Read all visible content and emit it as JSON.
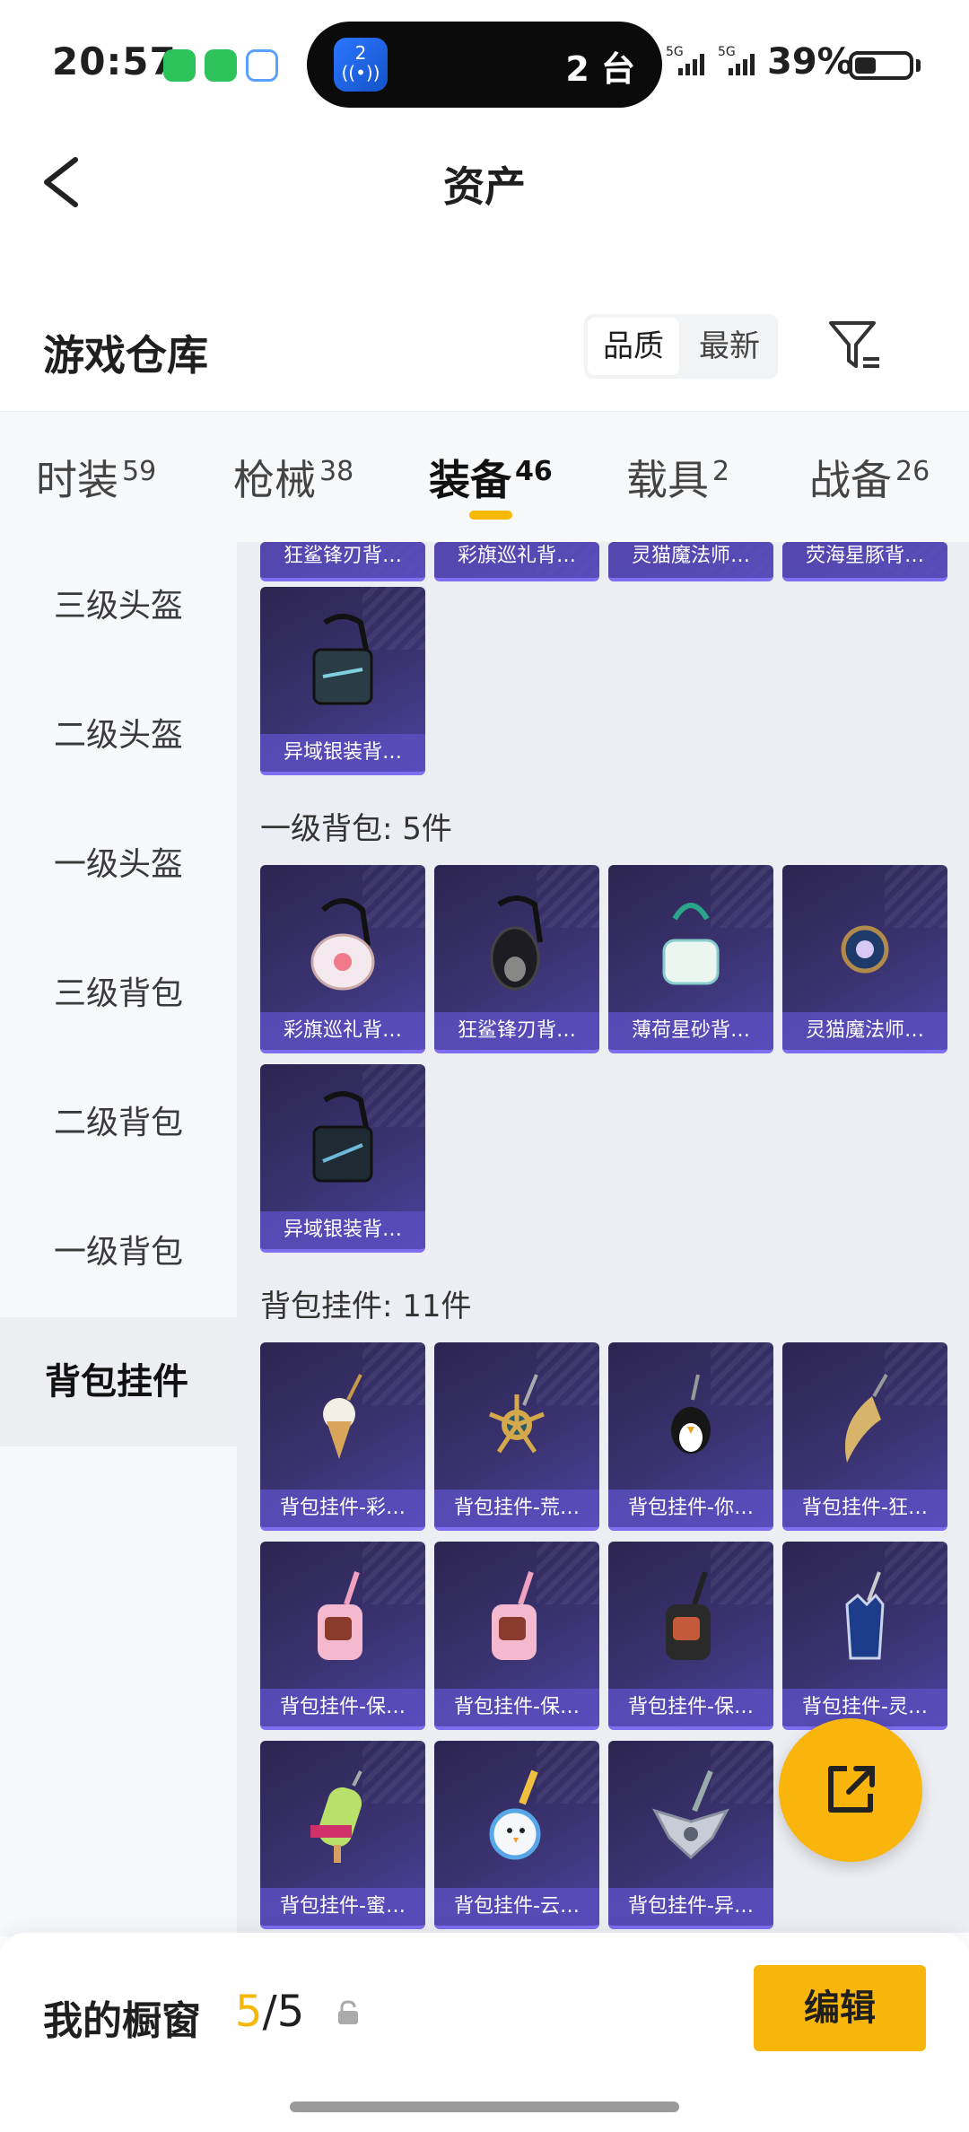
{
  "status_bar": {
    "time": "20:57",
    "island_app_badge": "2",
    "island_text": "2 台",
    "signal_1": "5G",
    "signal_2": "5G",
    "battery_percent": "39%",
    "battery_level": 0.39,
    "icons": [
      "wechat-icon",
      "wechat-icon",
      "assistant-icon"
    ]
  },
  "nav": {
    "title": "资产",
    "back_icon": "chevron-left-icon"
  },
  "header": {
    "title": "游戏仓库",
    "sort_options": [
      "品质",
      "最新"
    ],
    "sort_selected": "品质",
    "filter_icon": "filter-icon"
  },
  "category_tabs": [
    {
      "label": "时装",
      "count": "59"
    },
    {
      "label": "枪械",
      "count": "38"
    },
    {
      "label": "装备",
      "count": "46",
      "active": true
    },
    {
      "label": "载具",
      "count": "2"
    },
    {
      "label": "战备",
      "count": "26"
    }
  ],
  "sidebar": [
    "三级头盔",
    "二级头盔",
    "一级头盔",
    "三级背包",
    "二级背包",
    "一级背包",
    "背包挂件"
  ],
  "sidebar_active": "背包挂件",
  "content": {
    "top_partial_row": [
      "狂鲨锋刃背…",
      "彩旗巡礼背…",
      "灵猫魔法师…",
      "荧海星豚背…"
    ],
    "section_prev_tail": [
      "异域银装背…"
    ],
    "section_level1": {
      "title": "一级背包: 5件",
      "items": [
        "彩旗巡礼背…",
        "狂鲨锋刃背…",
        "薄荷星砂背…",
        "灵猫魔法师…",
        "异域银装背…"
      ]
    },
    "section_pendant": {
      "title": "背包挂件: 11件",
      "items": [
        "背包挂件-彩…",
        "背包挂件-荒…",
        "背包挂件-你…",
        "背包挂件-狂…",
        "背包挂件-保…",
        "背包挂件-保…",
        "背包挂件-保…",
        "背包挂件-灵…",
        "背包挂件-蜜…",
        "背包挂件-云…",
        "背包挂件-异…"
      ]
    }
  },
  "share_button_icon": "share-out-icon",
  "bottom_bar": {
    "label": "我的橱窗",
    "count_current": "5",
    "count_sep": "/",
    "count_total": "5",
    "lock_icon": "lock-icon",
    "edit_label": "编辑"
  },
  "colors": {
    "accent": "#f8b60a",
    "card": "#3a3370",
    "card_label": "#5a4ebe"
  }
}
